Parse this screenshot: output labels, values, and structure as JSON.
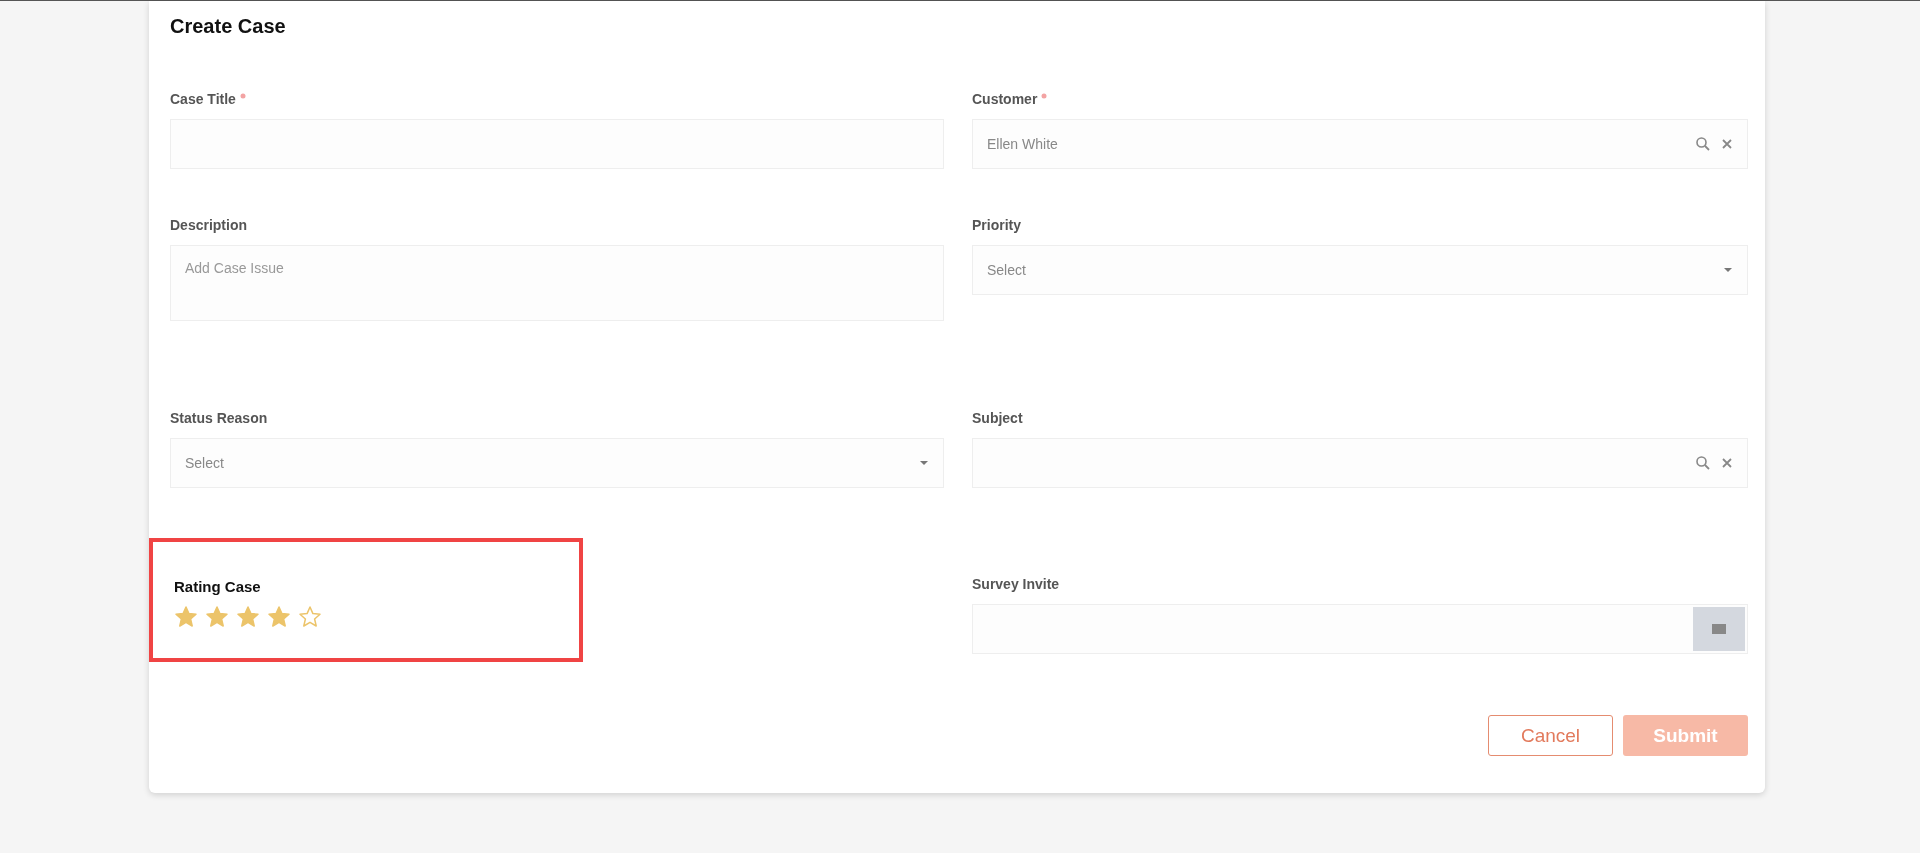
{
  "title": "Create Case",
  "left_fields": [
    {
      "kind": "text",
      "label": "Case Title",
      "required": true
    },
    {
      "kind": "textarea",
      "label": "Description",
      "required": false,
      "placeholder": "Add Case Issue"
    },
    {
      "kind": "select",
      "label": "Status Reason",
      "required": false,
      "placeholder": "Select"
    }
  ],
  "right_fields": [
    {
      "kind": "lookup",
      "label": "Customer",
      "required": true,
      "value": "Ellen White"
    },
    {
      "kind": "select",
      "label": "Priority",
      "required": false,
      "placeholder": "Select"
    },
    {
      "kind": "lookup",
      "label": "Subject",
      "required": false
    }
  ],
  "rating": {
    "label": "Rating Case",
    "stars": 4,
    "highlighted": true
  },
  "survey": {
    "label": "Survey Invite"
  },
  "buttons": [
    {
      "kind": "secondary",
      "label": "Cancel"
    },
    {
      "kind": "primary",
      "label": "Submit",
      "disabled": true
    }
  ]
}
